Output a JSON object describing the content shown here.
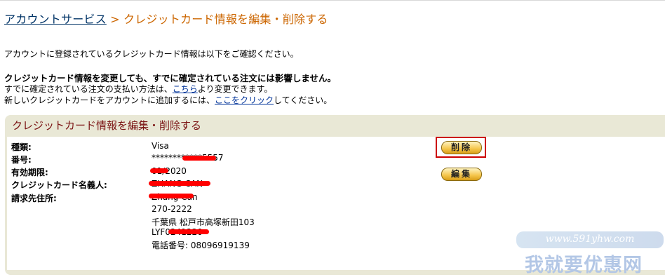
{
  "breadcrumb": {
    "parent_label": "アカウントサービス",
    "separator": ">",
    "current_label": "クレジットカード情報を編集・削除する"
  },
  "intro_text": "アカウントに登録されているクレジットカード情報は以下をご確認ください。",
  "notice_strong": "クレジットカード情報を変更しても、すでに確定されている注文には影響しません。",
  "line3": {
    "before": "すでに確定されている注文の支払い方法は、",
    "link": "こちら",
    "after": "より変更できます。"
  },
  "line4": {
    "before": "新しいクレジットカードをアカウントに追加するには、",
    "link": "ここをクリック",
    "after": "してください。"
  },
  "panel": {
    "title": "クレジットカード情報を編集・削除する",
    "fields": {
      "type_label": "種類:",
      "type_value": "Visa",
      "number_label": "番号:",
      "number_value": "************5557",
      "expiry_label": "有効期限:",
      "expiry_value": "01/2020",
      "holder_label": "クレジットカード名義人:",
      "holder_value": "ZHANG CAN",
      "address_label": "請求先住所:",
      "address_lines": {
        "name": "Zhang Can",
        "postal": "270-2222",
        "city": "千葉県 松戸市高塚新田103",
        "building": "LYF0241220",
        "phone": "電話番号: 08096919139"
      }
    },
    "delete_button": "削除",
    "edit_button": "編集"
  },
  "watermark": {
    "url": "www.591yhw.com",
    "text": "我就要优惠网"
  },
  "colors": {
    "breadcrumb_link": "#003366",
    "breadcrumb_current": "#cc6600",
    "panel_title": "#7a1212",
    "highlight_box": "#cc0000"
  }
}
